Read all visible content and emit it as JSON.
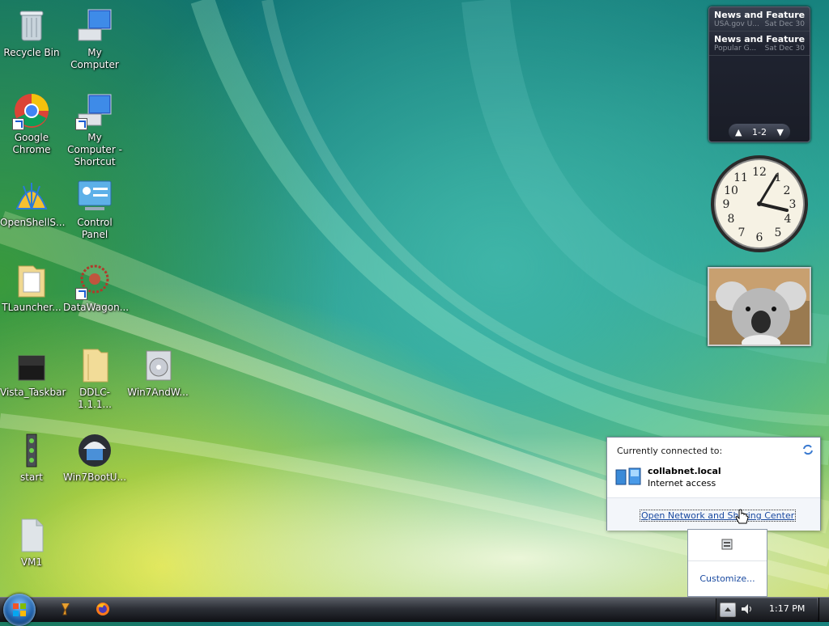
{
  "desktop_icons": [
    {
      "label": "Recycle Bin"
    },
    {
      "label": "My Computer"
    },
    {
      "label": "Google Chrome"
    },
    {
      "label": "My Computer - Shortcut"
    },
    {
      "label": "OpenShellS..."
    },
    {
      "label": "Control Panel"
    },
    {
      "label": "TLauncher..."
    },
    {
      "label": "DataWagon..."
    },
    {
      "label": "Vista_Taskbar"
    },
    {
      "label": "DDLC-1.1.1..."
    },
    {
      "label": "Win7AndW..."
    },
    {
      "label": "start"
    },
    {
      "label": "Win7BootU..."
    },
    {
      "label": "VM1"
    }
  ],
  "rss_gadget": {
    "items": [
      {
        "title": "News and Features f...",
        "source": "USA.gov U...",
        "date": "Sat Dec 30"
      },
      {
        "title": "News and Feature...",
        "source": "Popular G...",
        "date": "Sat Dec 30"
      }
    ],
    "page": "1-2"
  },
  "clock_gadget": {
    "time": "1:17"
  },
  "network_popup": {
    "heading": "Currently connected to:",
    "network_name": "collabnet.local",
    "access": "Internet access",
    "link": "Open Network and Sharing Center"
  },
  "tray_overflow": {
    "customize": "Customize..."
  },
  "taskbar": {
    "clock": "1:17 PM"
  }
}
